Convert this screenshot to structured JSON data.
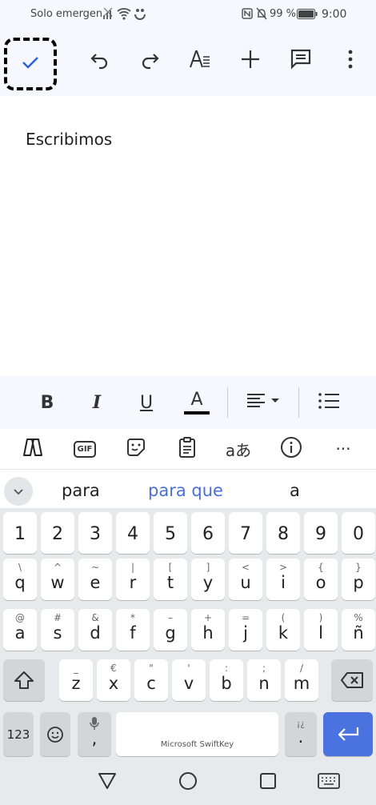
{
  "status_bar": {
    "carrier": "Solo emergen…",
    "battery": "99 %",
    "time": "9:00"
  },
  "toolbar": {
    "done_icon": "check-icon",
    "buttons": [
      "undo-icon",
      "redo-icon",
      "text-format-icon",
      "add-icon",
      "comment-icon",
      "more-vert-icon"
    ]
  },
  "document": {
    "text": "Escribimos"
  },
  "format_bar": {
    "bold": "B",
    "italic": "I",
    "underline": "U",
    "text_color": "A",
    "text_color_value": "#000000",
    "align": "align-left-icon",
    "list": "bulleted-list-icon"
  },
  "keyboard": {
    "tools": [
      "copilot-icon",
      "gif-icon",
      "sticker-icon",
      "clipboard-icon",
      "translate-icon",
      "info-icon",
      "more-horiz-icon"
    ],
    "gif_label": "GIF",
    "translate_label": "aあ",
    "more_label": "···",
    "suggestions": [
      "para",
      "para que",
      "a"
    ],
    "suggestion_highlight_color": "#4a6fd8",
    "row_numbers": [
      "1",
      "2",
      "3",
      "4",
      "5",
      "6",
      "7",
      "8",
      "9",
      "0"
    ],
    "row1": [
      {
        "main": "q",
        "sec": "\\"
      },
      {
        "main": "w",
        "sec": "^"
      },
      {
        "main": "e",
        "sec": "~"
      },
      {
        "main": "r",
        "sec": "|"
      },
      {
        "main": "t",
        "sec": "["
      },
      {
        "main": "y",
        "sec": "]"
      },
      {
        "main": "u",
        "sec": "<"
      },
      {
        "main": "i",
        "sec": ">"
      },
      {
        "main": "o",
        "sec": "{"
      },
      {
        "main": "p",
        "sec": "}"
      }
    ],
    "row2": [
      {
        "main": "a",
        "sec": "@"
      },
      {
        "main": "s",
        "sec": "#"
      },
      {
        "main": "d",
        "sec": "&"
      },
      {
        "main": "f",
        "sec": "*"
      },
      {
        "main": "g",
        "sec": "–"
      },
      {
        "main": "h",
        "sec": "+"
      },
      {
        "main": "j",
        "sec": "="
      },
      {
        "main": "k",
        "sec": "("
      },
      {
        "main": "l",
        "sec": ")"
      },
      {
        "main": "ñ",
        "sec": "%"
      }
    ],
    "row3": [
      {
        "main": "z",
        "sec": "_"
      },
      {
        "main": "x",
        "sec": "€"
      },
      {
        "main": "c",
        "sec": "\""
      },
      {
        "main": "v",
        "sec": "'"
      },
      {
        "main": "b",
        "sec": ":"
      },
      {
        "main": "n",
        "sec": ";"
      },
      {
        "main": "m",
        "sec": "/"
      }
    ],
    "key_123": "123",
    "comma": ",",
    "space_label": "Microsoft SwiftKey",
    "period": ".",
    "period_sec": "¡¿",
    "enter_color": "#4a73e0"
  },
  "nav_bar": [
    "back-triangle-icon",
    "home-circle-icon",
    "recents-square-icon",
    "keyboard-icon"
  ]
}
